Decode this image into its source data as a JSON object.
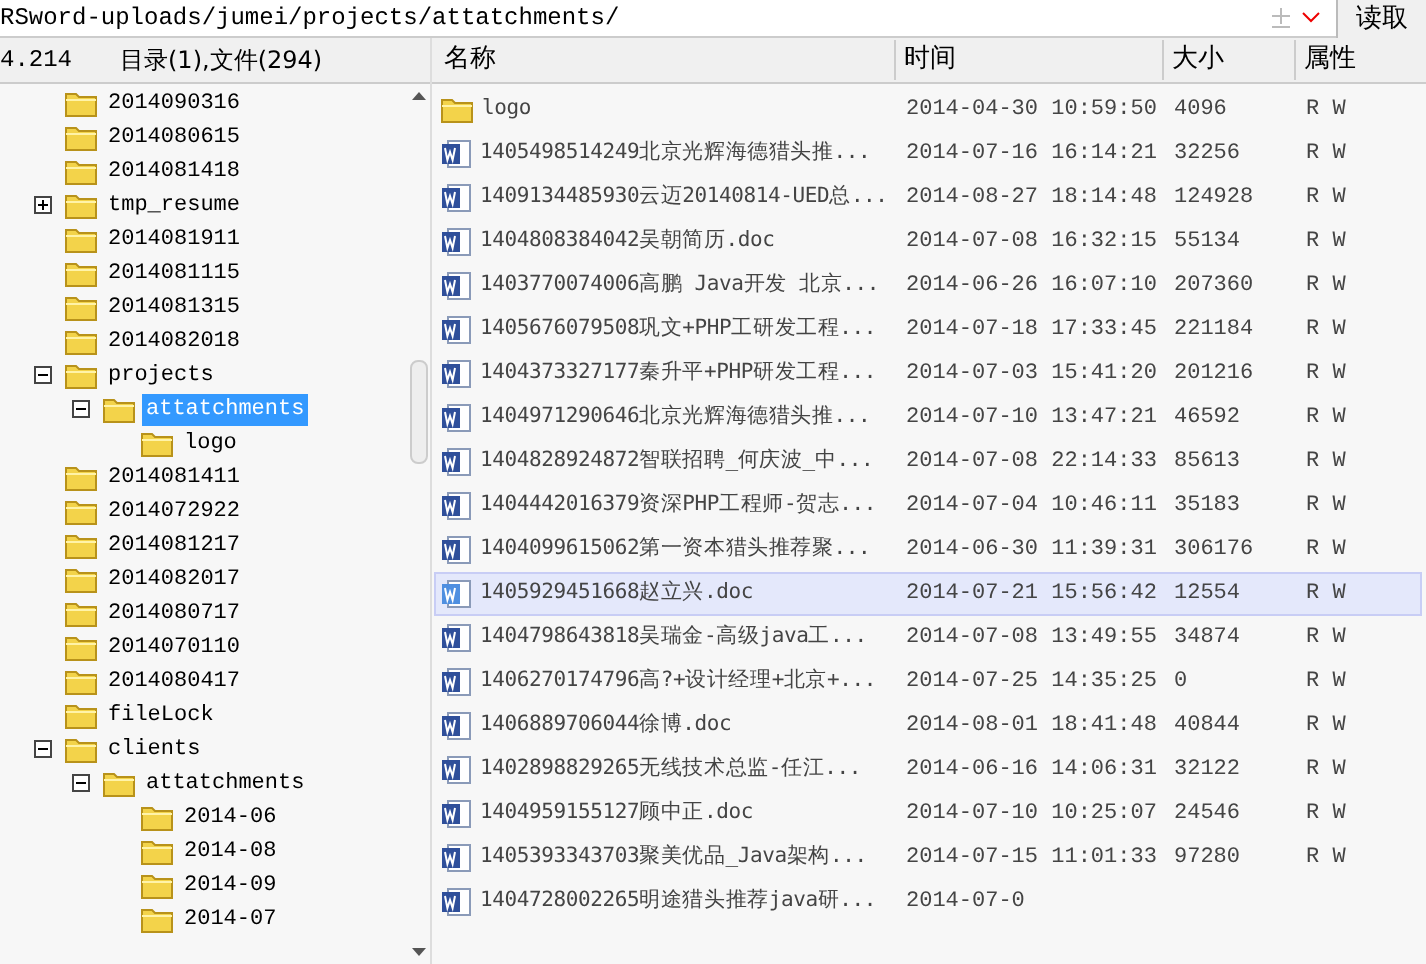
{
  "path_bar": {
    "path": "RSword-uploads/jumei/projects/attatchments/",
    "button": "读取"
  },
  "tree_header": {
    "address": "4.214",
    "summary": "目录(1),文件(294)"
  },
  "tree": [
    {
      "label": "2014090316",
      "selected": false
    },
    {
      "label": "2014080615",
      "selected": false
    },
    {
      "label": "2014081418",
      "selected": false
    },
    {
      "label": "tmp_resume",
      "selected": false,
      "expanded": false
    },
    {
      "label": "2014081911",
      "selected": false
    },
    {
      "label": "2014081115",
      "selected": false
    },
    {
      "label": "2014081315",
      "selected": false
    },
    {
      "label": "2014082018",
      "selected": false
    },
    {
      "label": "projects",
      "selected": false,
      "expanded": true,
      "children": [
        {
          "label": "attatchments",
          "selected": true,
          "expanded": true,
          "children": [
            {
              "label": "logo",
              "selected": false
            }
          ]
        }
      ]
    },
    {
      "label": "2014081411",
      "selected": false
    },
    {
      "label": "2014072922",
      "selected": false
    },
    {
      "label": "2014081217",
      "selected": false
    },
    {
      "label": "2014082017",
      "selected": false
    },
    {
      "label": "2014080717",
      "selected": false
    },
    {
      "label": "2014070110",
      "selected": false
    },
    {
      "label": "2014080417",
      "selected": false
    },
    {
      "label": "fileLock",
      "selected": false
    },
    {
      "label": "clients",
      "selected": false,
      "expanded": true,
      "children": [
        {
          "label": "attatchments",
          "selected": false,
          "expanded": true,
          "children": [
            {
              "label": "2014-06",
              "selected": false
            },
            {
              "label": "2014-08",
              "selected": false
            },
            {
              "label": "2014-09",
              "selected": false
            },
            {
              "label": "2014-07",
              "selected": false
            }
          ]
        }
      ]
    }
  ],
  "table": {
    "columns": [
      "名称",
      "时间",
      "大小",
      "属性"
    ],
    "rows": [
      {
        "kind": "folder",
        "name": "logo",
        "time": "2014-04-30 10:59:50",
        "size": "4096",
        "attr": "R W",
        "selected": false
      },
      {
        "kind": "doc",
        "name": "1405498514249北京光辉海德猎头推...",
        "time": "2014-07-16 16:14:21",
        "size": "32256",
        "attr": "R W",
        "selected": false
      },
      {
        "kind": "doc",
        "name": "1409134485930云迈20140814-UED总...",
        "time": "2014-08-27 18:14:48",
        "size": "124928",
        "attr": "R W",
        "selected": false
      },
      {
        "kind": "doc",
        "name": "1404808384042吴朝简历.doc",
        "time": "2014-07-08 16:32:15",
        "size": "55134",
        "attr": "R W",
        "selected": false
      },
      {
        "kind": "doc",
        "name": "1403770074006高鹏 Java开发 北京...",
        "time": "2014-06-26 16:07:10",
        "size": "207360",
        "attr": "R W",
        "selected": false
      },
      {
        "kind": "doc",
        "name": "1405676079508巩文+PHP工研发工程...",
        "time": "2014-07-18 17:33:45",
        "size": "221184",
        "attr": "R W",
        "selected": false
      },
      {
        "kind": "doc",
        "name": "1404373327177秦升平+PHP研发工程...",
        "time": "2014-07-03 15:41:20",
        "size": "201216",
        "attr": "R W",
        "selected": false
      },
      {
        "kind": "doc",
        "name": "1404971290646北京光辉海德猎头推...",
        "time": "2014-07-10 13:47:21",
        "size": "46592",
        "attr": "R W",
        "selected": false
      },
      {
        "kind": "doc",
        "name": "1404828924872智联招聘_何庆波_中...",
        "time": "2014-07-08 22:14:33",
        "size": "85613",
        "attr": "R W",
        "selected": false
      },
      {
        "kind": "doc",
        "name": "1404442016379资深PHP工程师-贺志...",
        "time": "2014-07-04 10:46:11",
        "size": "35183",
        "attr": "R W",
        "selected": false
      },
      {
        "kind": "doc",
        "name": "1404099615062第一资本猎头推荐聚...",
        "time": "2014-06-30 11:39:31",
        "size": "306176",
        "attr": "R W",
        "selected": false
      },
      {
        "kind": "doc",
        "name": "1405929451668赵立兴.doc",
        "time": "2014-07-21 15:56:42",
        "size": "12554",
        "attr": "R W",
        "selected": true
      },
      {
        "kind": "doc",
        "name": "1404798643818吴瑞金-高级java工...",
        "time": "2014-07-08 13:49:55",
        "size": "34874",
        "attr": "R W",
        "selected": false
      },
      {
        "kind": "doc",
        "name": "1406270174796高?+设计经理+北京+...",
        "time": "2014-07-25 14:35:25",
        "size": "0",
        "attr": "R W",
        "selected": false
      },
      {
        "kind": "doc",
        "name": "1406889706044徐博.doc",
        "time": "2014-08-01 18:41:48",
        "size": "40844",
        "attr": "R W",
        "selected": false
      },
      {
        "kind": "doc",
        "name": "1402898829265无线技术总监-任江...",
        "time": "2014-06-16 14:06:31",
        "size": "32122",
        "attr": "R W",
        "selected": false
      },
      {
        "kind": "doc",
        "name": "1404959155127顾中正.doc",
        "time": "2014-07-10 10:25:07",
        "size": "24546",
        "attr": "R W",
        "selected": false
      },
      {
        "kind": "doc",
        "name": "1405393343703聚美优品_Java架构...",
        "time": "2014-07-15 11:01:33",
        "size": "97280",
        "attr": "R W",
        "selected": false
      },
      {
        "kind": "doc",
        "name": "1404728002265明途猎头推荐java研...",
        "time": "2014-07-0",
        "selected": false
      }
    ]
  }
}
